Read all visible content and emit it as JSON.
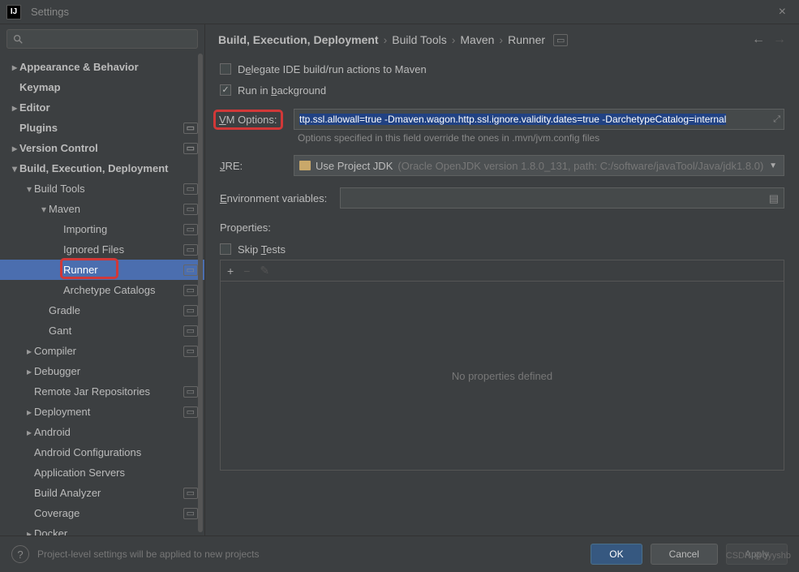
{
  "window": {
    "title": "Settings"
  },
  "sidebar": {
    "items": [
      {
        "label": "Appearance & Behavior",
        "arrow": "collapsed",
        "indent": 0,
        "bold": true
      },
      {
        "label": "Keymap",
        "arrow": "none",
        "indent": 0,
        "bold": true
      },
      {
        "label": "Editor",
        "arrow": "collapsed",
        "indent": 0,
        "bold": true
      },
      {
        "label": "Plugins",
        "arrow": "none",
        "indent": 0,
        "bold": true,
        "badge": true
      },
      {
        "label": "Version Control",
        "arrow": "collapsed",
        "indent": 0,
        "bold": true,
        "badge": true
      },
      {
        "label": "Build, Execution, Deployment",
        "arrow": "expanded",
        "indent": 0,
        "bold": true
      },
      {
        "label": "Build Tools",
        "arrow": "expanded",
        "indent": 1,
        "badge": true
      },
      {
        "label": "Maven",
        "arrow": "expanded",
        "indent": 2,
        "badge": true
      },
      {
        "label": "Importing",
        "arrow": "none",
        "indent": 3,
        "badge": true
      },
      {
        "label": "Ignored Files",
        "arrow": "none",
        "indent": 3,
        "badge": true
      },
      {
        "label": "Runner",
        "arrow": "none",
        "indent": 3,
        "badge": true,
        "selected": true,
        "highlight": true
      },
      {
        "label": "Archetype Catalogs",
        "arrow": "none",
        "indent": 3,
        "badge": true
      },
      {
        "label": "Gradle",
        "arrow": "none",
        "indent": 2,
        "badge": true
      },
      {
        "label": "Gant",
        "arrow": "none",
        "indent": 2,
        "badge": true
      },
      {
        "label": "Compiler",
        "arrow": "collapsed",
        "indent": 1,
        "badge": true
      },
      {
        "label": "Debugger",
        "arrow": "collapsed",
        "indent": 1
      },
      {
        "label": "Remote Jar Repositories",
        "arrow": "none",
        "indent": 1,
        "badge": true
      },
      {
        "label": "Deployment",
        "arrow": "collapsed",
        "indent": 1,
        "badge": true
      },
      {
        "label": "Android",
        "arrow": "collapsed",
        "indent": 1
      },
      {
        "label": "Android Configurations",
        "arrow": "none",
        "indent": 1
      },
      {
        "label": "Application Servers",
        "arrow": "none",
        "indent": 1
      },
      {
        "label": "Build Analyzer",
        "arrow": "none",
        "indent": 1,
        "badge": true
      },
      {
        "label": "Coverage",
        "arrow": "none",
        "indent": 1,
        "badge": true
      },
      {
        "label": "Docker",
        "arrow": "collapsed",
        "indent": 1
      }
    ]
  },
  "breadcrumb": {
    "items": [
      "Build, Execution, Deployment",
      "Build Tools",
      "Maven",
      "Runner"
    ]
  },
  "form": {
    "delegate_label_pre": "D",
    "delegate_label_ul": "e",
    "delegate_label_post": "legate IDE build/run actions to Maven",
    "background_label_pre": "Run in ",
    "background_label_ul": "b",
    "background_label_post": "ackground",
    "vm_label_ul": "V",
    "vm_label_post": "M Options:",
    "vm_value": "ttp.ssl.allowall=true -Dmaven.wagon.http.ssl.ignore.validity.dates=true -DarchetypeCatalog=internal",
    "vm_hint": "Options specified in this field override the ones in .mvn/jvm.config files",
    "jre_label_ul": "J",
    "jre_label_post": "RE:",
    "jre_value": "Use Project JDK",
    "jre_detail": "(Oracle OpenJDK version 1.8.0_131, path: C:/software/javaTool/Java/jdk1.8.0)",
    "env_label_ul": "E",
    "env_label_post": "nvironment variables:",
    "props_label": "Properties:",
    "skip_tests_pre": "Skip ",
    "skip_tests_ul": "T",
    "skip_tests_post": "ests",
    "props_empty": "No properties defined"
  },
  "footer": {
    "note": "Project-level settings will be applied to new projects",
    "ok": "OK",
    "cancel": "Cancel",
    "apply": "Apply",
    "watermark": "CSDN @dyyshb"
  }
}
